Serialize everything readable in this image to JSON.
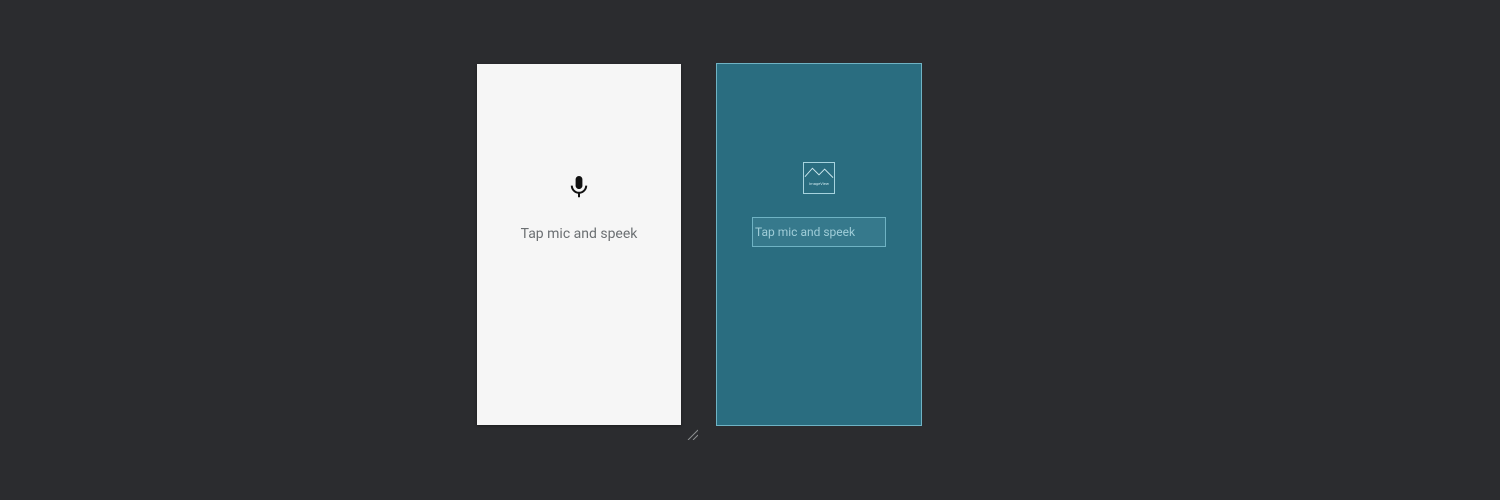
{
  "preview": {
    "prompt": "Tap mic and speek"
  },
  "blueprint": {
    "image_caption": "ImageView",
    "text_value": "Tap mic and speek"
  }
}
